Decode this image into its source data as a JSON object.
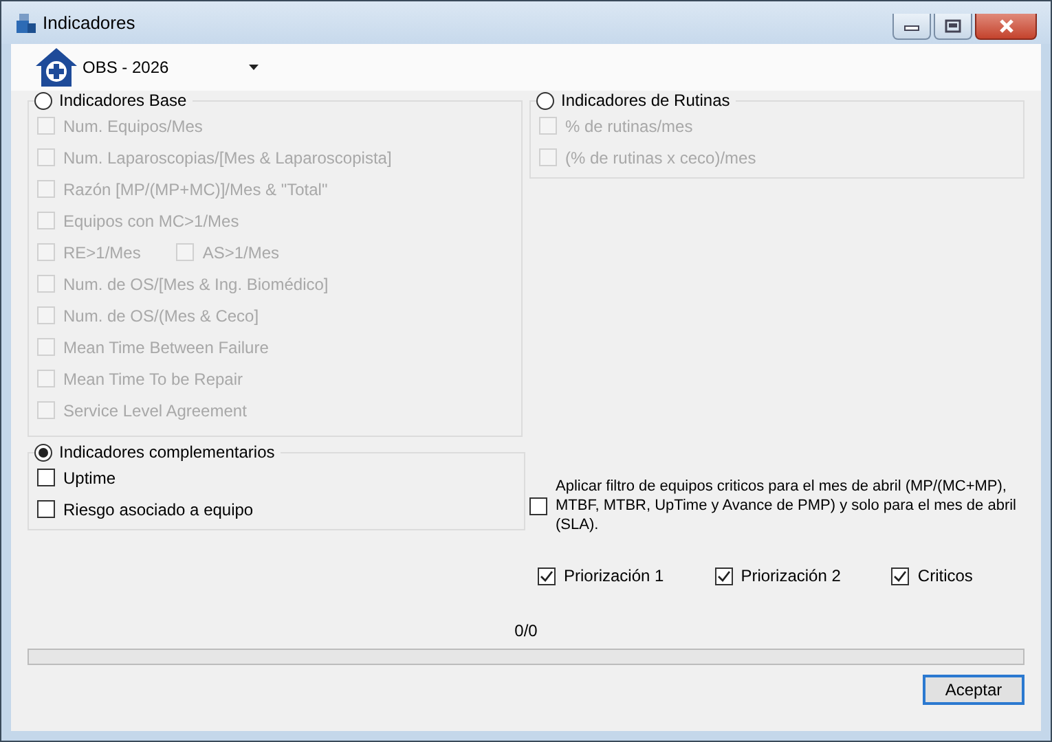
{
  "window": {
    "title": "Indicadores"
  },
  "site_selector": {
    "value": "OBS - 2026"
  },
  "base_group": {
    "label": "Indicadores Base",
    "selected": false,
    "rows": [
      {
        "items": [
          {
            "label": "Num. Equipos/Mes",
            "checked": false,
            "disabled": true
          }
        ]
      },
      {
        "items": [
          {
            "label": "Num. Laparoscopias/[Mes & Laparoscopista]",
            "checked": false,
            "disabled": true
          }
        ]
      },
      {
        "items": [
          {
            "label": "Razón [MP/(MP+MC)]/Mes & \"Total\"",
            "checked": false,
            "disabled": true
          }
        ]
      },
      {
        "items": [
          {
            "label": "Equipos con MC>1/Mes",
            "checked": false,
            "disabled": true
          }
        ]
      },
      {
        "items": [
          {
            "label": "RE>1/Mes",
            "checked": false,
            "disabled": true
          },
          {
            "label": "AS>1/Mes",
            "checked": false,
            "disabled": true
          }
        ]
      },
      {
        "items": [
          {
            "label": "Num. de OS/[Mes  & Ing. Biomédico]",
            "checked": false,
            "disabled": true
          }
        ]
      },
      {
        "items": [
          {
            "label": "Num. de OS/(Mes  & Ceco]",
            "checked": false,
            "disabled": true
          }
        ]
      },
      {
        "items": [
          {
            "label": "Mean Time Between Failure",
            "checked": false,
            "disabled": true
          }
        ]
      },
      {
        "items": [
          {
            "label": "Mean Time To be Repair",
            "checked": false,
            "disabled": true
          }
        ]
      },
      {
        "items": [
          {
            "label": "Service Level Agreement",
            "checked": false,
            "disabled": true
          }
        ]
      }
    ]
  },
  "routines_group": {
    "label": "Indicadores de Rutinas",
    "selected": false,
    "rows": [
      {
        "items": [
          {
            "label": "% de rutinas/mes",
            "checked": false,
            "disabled": true
          }
        ]
      },
      {
        "items": [
          {
            "label": "(% de rutinas x ceco)/mes",
            "checked": false,
            "disabled": true
          }
        ]
      }
    ]
  },
  "complementary_group": {
    "label": "Indicadores complementarios",
    "selected": true,
    "rows": [
      {
        "items": [
          {
            "label": "Uptime",
            "checked": false,
            "disabled": false
          }
        ]
      },
      {
        "items": [
          {
            "label": "Riesgo asociado a equipo",
            "checked": false,
            "disabled": false
          }
        ]
      }
    ]
  },
  "critical_filter": {
    "label": "Aplicar filtro de equipos criticos para el mes de abril (MP/(MC+MP), MTBF, MTBR, UpTime y Avance de PMP) y solo para el mes de abril (SLA).",
    "checked": false
  },
  "priorities": [
    {
      "label": "Priorización 1",
      "checked": true
    },
    {
      "label": "Priorización 2",
      "checked": true
    },
    {
      "label": "Criticos",
      "checked": true
    }
  ],
  "progress": {
    "reading": "0/0",
    "level": 0
  },
  "buttons": [
    {
      "label": "Aceptar",
      "default": true
    }
  ]
}
